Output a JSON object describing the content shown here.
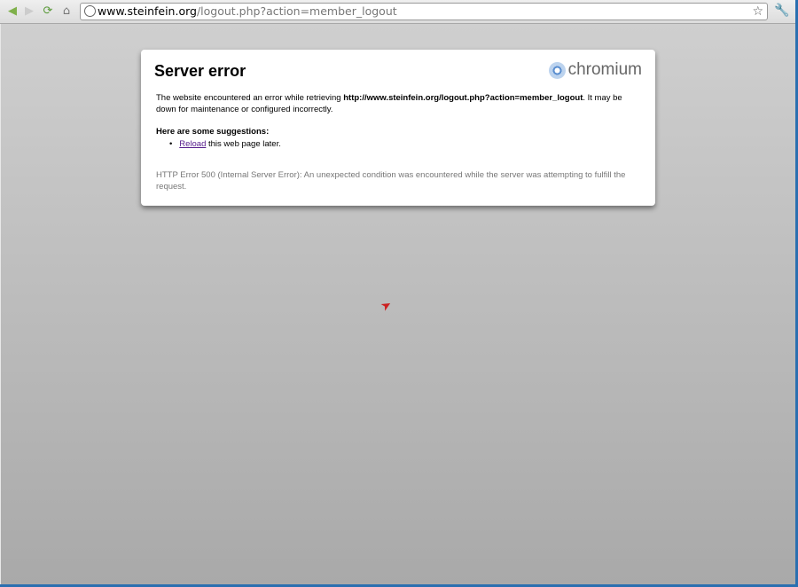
{
  "browser": {
    "url_host": "www.steinfein.org",
    "url_path": "/logout.php?action=member_logout"
  },
  "error": {
    "title": "Server error",
    "logo_text": "chromium",
    "message_pre": "The website encountered an error while retrieving ",
    "message_url": "http://www.steinfein.org/logout.php?action=member_logout",
    "message_post": ". It may be down for maintenance or configured incorrectly.",
    "suggestions_heading": "Here are some suggestions:",
    "reload_link": "Reload",
    "reload_rest": " this web page later.",
    "detail": "HTTP Error 500 (Internal Server Error): An unexpected condition was encountered while the server was attempting to fulfill the request."
  }
}
